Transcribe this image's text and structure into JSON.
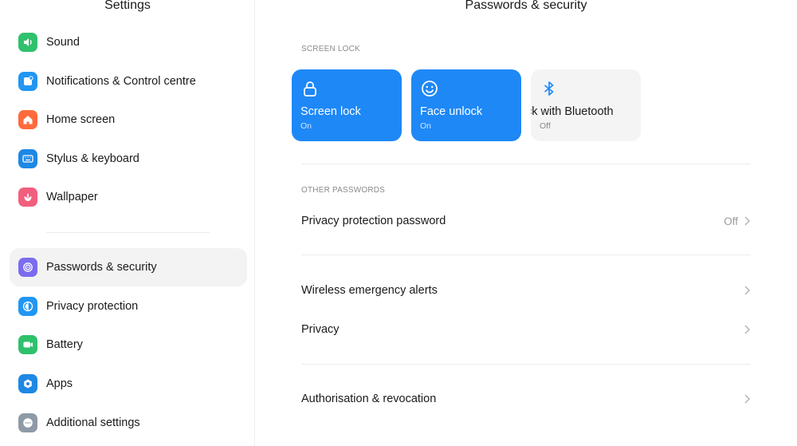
{
  "sidebar": {
    "title": "Settings",
    "items": [
      {
        "label": "Sound",
        "icon": "speaker-icon",
        "color": "#2fc16c"
      },
      {
        "label": "Notifications & Control centre",
        "icon": "notification-icon",
        "color": "#2196f3"
      },
      {
        "label": "Home screen",
        "icon": "home-icon",
        "color": "#ff6a3d"
      },
      {
        "label": "Stylus & keyboard",
        "icon": "keyboard-icon",
        "color": "#1e88e5"
      },
      {
        "label": "Wallpaper",
        "icon": "flower-icon",
        "color": "#f25f7e"
      },
      {
        "label": "Passwords & security",
        "icon": "target-icon",
        "color": "#7b6cf0",
        "active": true
      },
      {
        "label": "Privacy protection",
        "icon": "shield-icon",
        "color": "#2196f3"
      },
      {
        "label": "Battery",
        "icon": "battery-icon",
        "color": "#2fc16c"
      },
      {
        "label": "Apps",
        "icon": "gear-icon",
        "color": "#1e88e5"
      },
      {
        "label": "Additional settings",
        "icon": "more-icon",
        "color": "#8e9aa6"
      }
    ]
  },
  "main": {
    "title": "Passwords & security",
    "screen_lock_section": "SCREEN LOCK",
    "tiles": [
      {
        "name": "Screen lock",
        "status": "On",
        "icon": "lock-icon",
        "state": "on"
      },
      {
        "name": "Face unlock",
        "status": "On",
        "icon": "face-icon",
        "state": "on"
      },
      {
        "name": "ck with Bluetooth",
        "status": "Off",
        "icon": "bluetooth-icon",
        "state": "off"
      }
    ],
    "other_passwords_section": "OTHER PASSWORDS",
    "rows": [
      {
        "label": "Privacy protection password",
        "value": "Off"
      },
      {
        "label": "Wireless emergency alerts",
        "value": ""
      },
      {
        "label": "Privacy",
        "value": ""
      },
      {
        "label": "Authorisation & revocation",
        "value": ""
      }
    ]
  },
  "colors": {
    "accent": "#1e88f7",
    "tile_off": "#f4f4f5"
  }
}
